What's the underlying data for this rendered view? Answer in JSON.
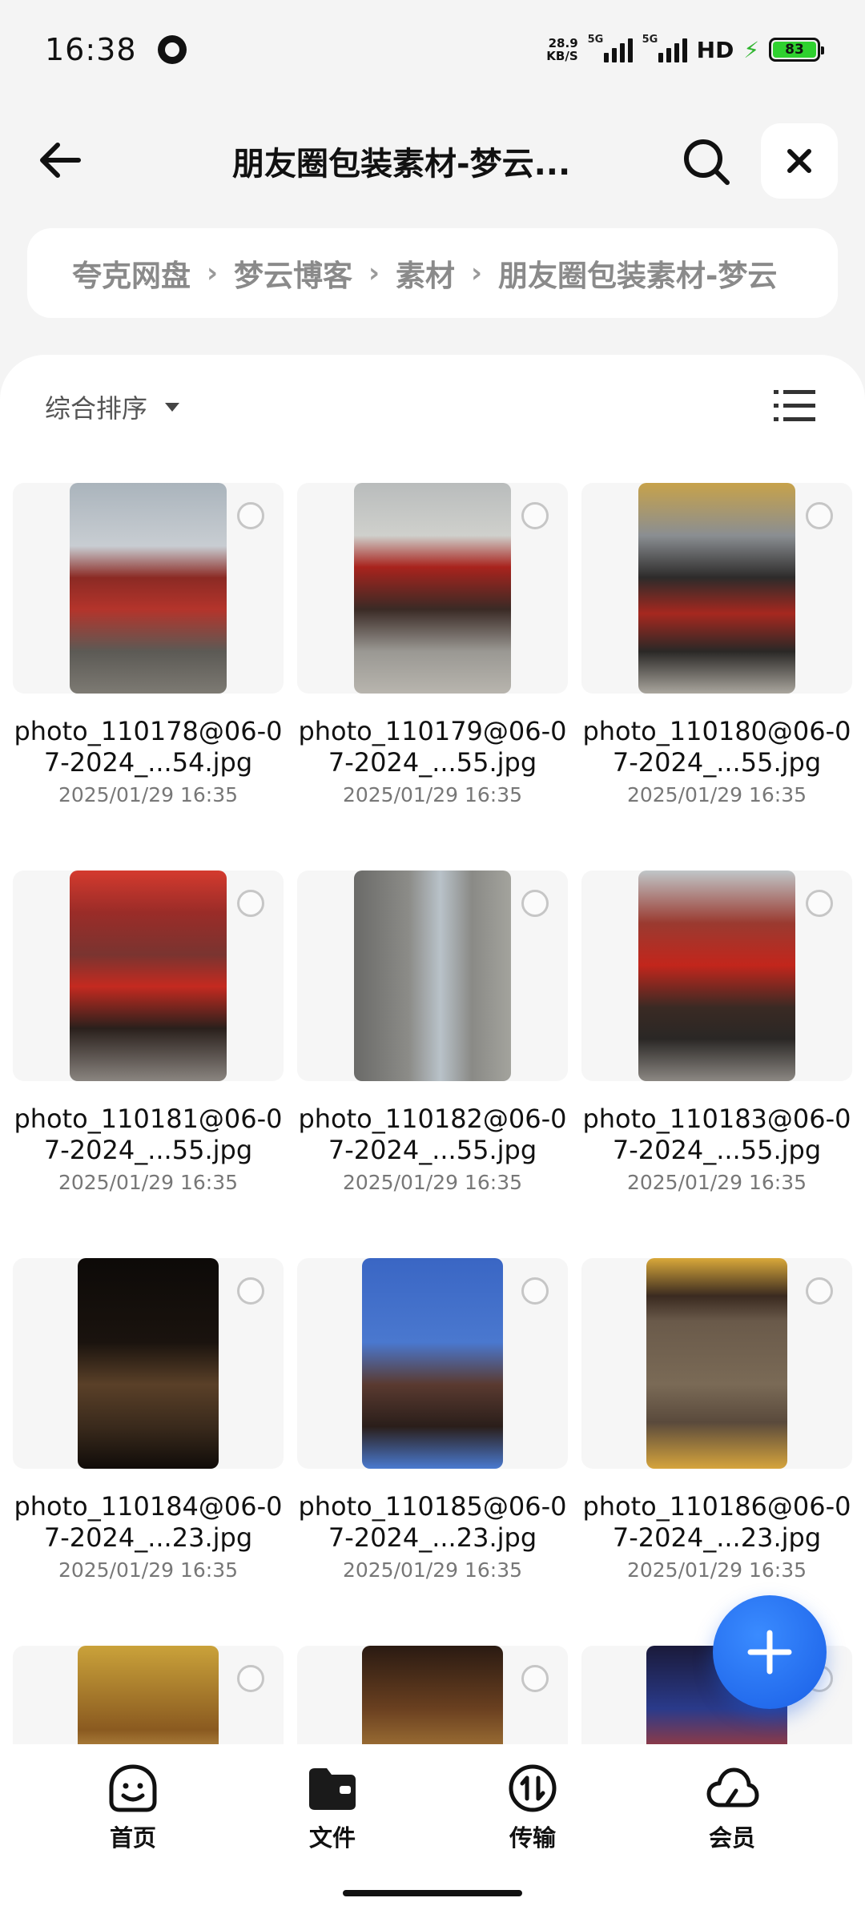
{
  "status_bar": {
    "time": "16:38",
    "net_speed_value": "28.9",
    "net_speed_unit": "KB/S",
    "signal1_label": "5G",
    "signal2_label": "5G",
    "hd_label": "HD",
    "battery": "83"
  },
  "header": {
    "title": "朋友圈包装素材-梦云...",
    "back_icon": "arrow-left-icon",
    "search_icon": "search-icon",
    "close_icon": "close-icon"
  },
  "breadcrumb": {
    "items": [
      "夸克网盘",
      "梦云博客",
      "素材",
      "朋友圈包装素材-梦云"
    ]
  },
  "toolbar": {
    "sort_label": "综合排序",
    "list_view_icon": "list-view-icon"
  },
  "files": [
    {
      "name": "photo_110178@06-07-2024_...54.jpg",
      "date": "2025/01/29 16:35"
    },
    {
      "name": "photo_110179@06-07-2024_...55.jpg",
      "date": "2025/01/29 16:35"
    },
    {
      "name": "photo_110180@06-07-2024_...55.jpg",
      "date": "2025/01/29 16:35"
    },
    {
      "name": "photo_110181@06-07-2024_...55.jpg",
      "date": "2025/01/29 16:35"
    },
    {
      "name": "photo_110182@06-07-2024_...55.jpg",
      "date": "2025/01/29 16:35"
    },
    {
      "name": "photo_110183@06-07-2024_...55.jpg",
      "date": "2025/01/29 16:35"
    },
    {
      "name": "photo_110184@06-07-2024_...23.jpg",
      "date": "2025/01/29 16:35"
    },
    {
      "name": "photo_110185@06-07-2024_...23.jpg",
      "date": "2025/01/29 16:35"
    },
    {
      "name": "photo_110186@06-07-2024_...23.jpg",
      "date": "2025/01/29 16:35"
    },
    {
      "name": "",
      "date": ""
    },
    {
      "name": "",
      "date": ""
    },
    {
      "name": "",
      "date": ""
    }
  ],
  "fab": {
    "icon": "plus-icon"
  },
  "bottom_nav": {
    "items": [
      {
        "label": "首页",
        "icon": "home-face-icon"
      },
      {
        "label": "文件",
        "icon": "folder-icon"
      },
      {
        "label": "传输",
        "icon": "transfer-icon"
      },
      {
        "label": "会员",
        "icon": "cloud-icon"
      }
    ]
  },
  "colors": {
    "accent": "#1a5fe6",
    "background": "#f4f4f4",
    "panel": "#ffffff"
  }
}
